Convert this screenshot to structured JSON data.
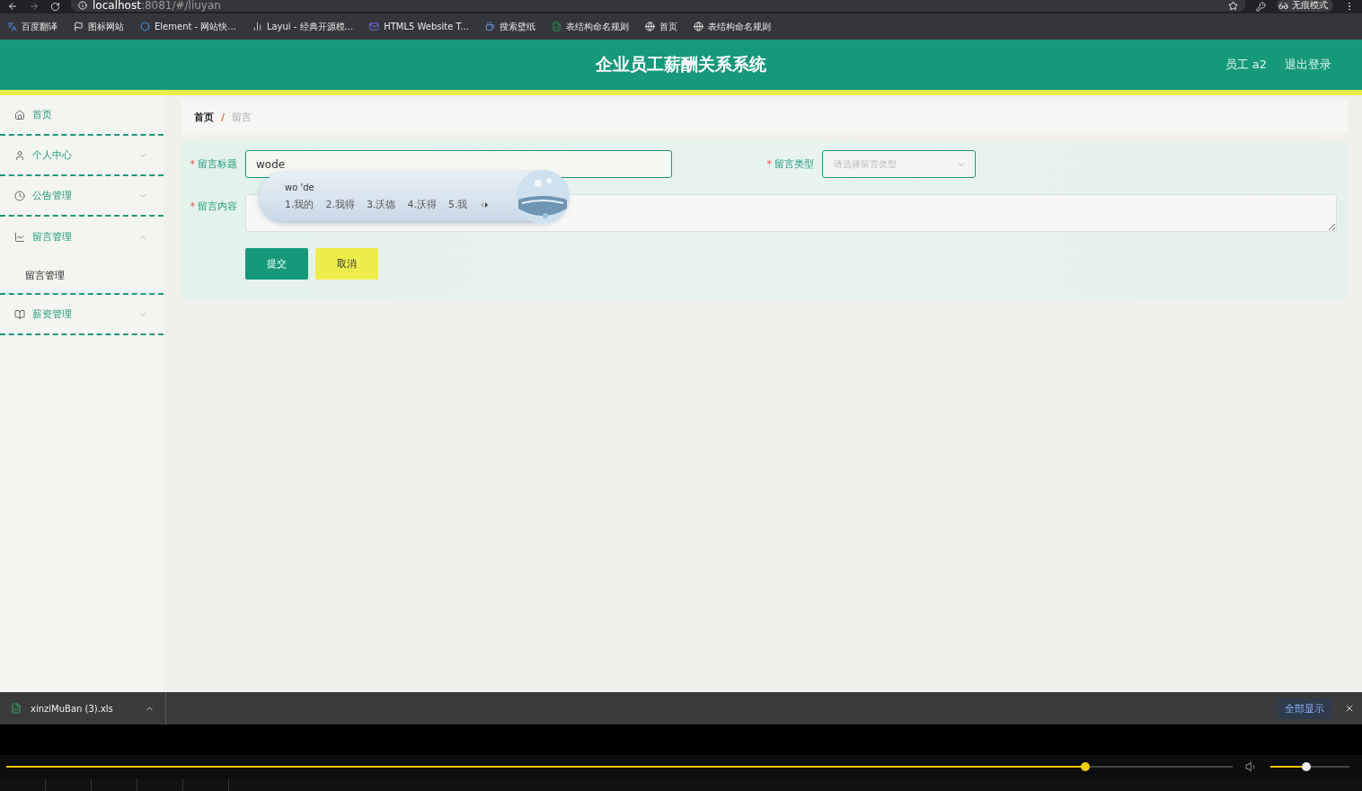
{
  "browser": {
    "url_host": "localhost",
    "url_path": ":8081/#/liuyan",
    "profile": "无痕模式"
  },
  "bookmarks": [
    {
      "label": "百度翻译",
      "kind": "translate"
    },
    {
      "label": "图标网站",
      "kind": "flag"
    },
    {
      "label": "Element - 网站快...",
      "kind": "hexagon"
    },
    {
      "label": "Layui - 经典开源模...",
      "kind": "bars"
    },
    {
      "label": "HTML5 Website T...",
      "kind": "mail"
    },
    {
      "label": "搜索壁纸",
      "kind": "cup"
    },
    {
      "label": "表结构命名规则",
      "kind": "sheet"
    },
    {
      "label": "首页",
      "kind": "globe"
    },
    {
      "label": "表结构命名规则",
      "kind": "globe"
    }
  ],
  "header": {
    "title": "企业员工薪酬关系系统",
    "user": "员工 a2",
    "logout": "退出登录"
  },
  "sidebar": {
    "items": [
      {
        "label": "首页",
        "kind": "link"
      },
      {
        "label": "个人中心",
        "kind": "menu",
        "expanded": false
      },
      {
        "label": "公告管理",
        "kind": "menu",
        "expanded": false
      },
      {
        "label": "留言管理",
        "kind": "menu",
        "expanded": true,
        "children": [
          {
            "label": "留言管理"
          }
        ]
      },
      {
        "label": "薪资管理",
        "kind": "menu",
        "expanded": false
      }
    ]
  },
  "breadcrumb": [
    {
      "label": "首页",
      "selected": false
    },
    {
      "label": "留言",
      "selected": true
    }
  ],
  "breadcrumb_separator": "/",
  "form": {
    "required_mark": "*",
    "title_field": {
      "label": "留言标题",
      "required": true,
      "value": "wode"
    },
    "type_field": {
      "label": "留言类型",
      "required": true,
      "placeholder": "请选择留言类型"
    },
    "content_field": {
      "label": "留言内容",
      "required": true
    },
    "buttons": [
      {
        "label": "提交",
        "kind": "primary"
      },
      {
        "label": "取消",
        "kind": "cancel"
      }
    ]
  },
  "ime": {
    "composition": "wo 'de",
    "candidates": [
      "1.我的",
      "2.我得",
      "3.沃德",
      "4.沃得",
      "5.我"
    ]
  },
  "downloads": {
    "file": "xinziMuBan (3).xls",
    "show_all": "全部显示"
  },
  "player": {
    "progress": {
      "level": 0.88
    },
    "volume": {
      "level": 0.45
    }
  }
}
